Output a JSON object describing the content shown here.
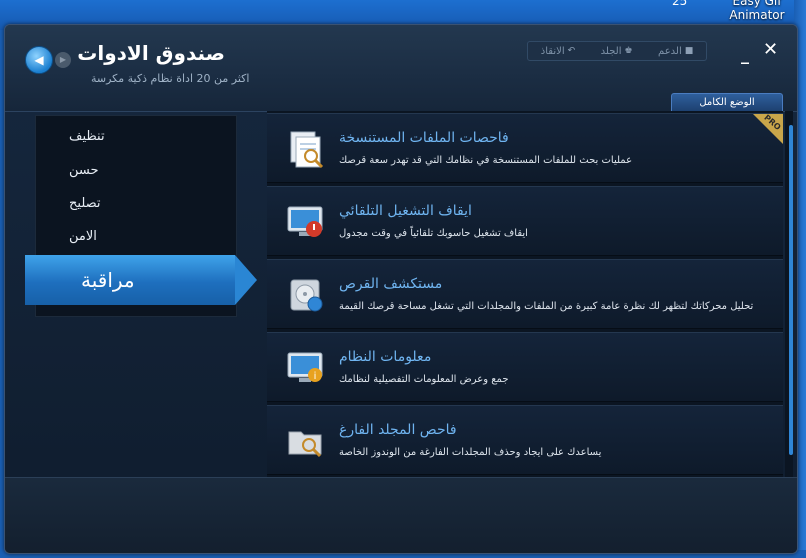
{
  "desktop": {
    "number": "25",
    "icon_label": "Easy Gif Animator"
  },
  "app": {
    "title": "صندوق الادوات",
    "subtitle": "اكثر من 20 اداة نظام ذكية مكرسة",
    "top_links": [
      {
        "label": "الدعم",
        "icon": "support-icon"
      },
      {
        "label": "الجلد",
        "icon": "skin-icon"
      },
      {
        "label": "الانقاذ",
        "icon": "rescue-icon"
      }
    ],
    "mode_tab": "الوضع الكامل"
  },
  "menu": {
    "items": [
      "تنظيف",
      "حسن",
      "تصليح",
      "الامن"
    ],
    "active": "مراقبة"
  },
  "tools": [
    {
      "title": "فاحصات الملفات المستنسخة",
      "desc": "عمليات بحث للملفات المستنسخة في نظامك التي قد تهدر سعة قرصك",
      "icon": "duplicate-files-icon",
      "badge": "PRO"
    },
    {
      "title": "ايقاف التشغيل التلقائي",
      "desc": "ايقاف تشغيل حاسوبك تلقائياً في وقت مجدول",
      "icon": "auto-shutdown-icon"
    },
    {
      "title": "مستكشف القرص",
      "desc": "تحليل محركاتك لتظهر لك نظرة عامة كبيرة من الملفات والمجلدات التي تشغل مساحة قرصك القيمة",
      "icon": "disk-explorer-icon"
    },
    {
      "title": "معلومات النظام",
      "desc": "جمع وعرض المعلومات التفصيلية لنظامك",
      "icon": "system-info-icon"
    },
    {
      "title": "فاحص المجلد الفارغ",
      "desc": "يساعدك على ايجاد وحذف المجلدات الفارغة من الوندوز الخاصة",
      "icon": "empty-folder-icon"
    }
  ],
  "colors": {
    "accent": "#2f86d6",
    "title_blue": "#6fb4f0",
    "panel_dark": "#0b1522"
  }
}
